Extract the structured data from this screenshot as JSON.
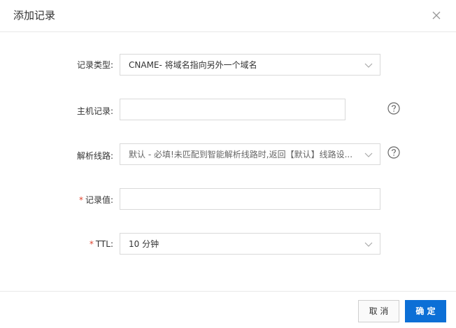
{
  "dialog": {
    "title": "添加记录"
  },
  "form": {
    "record_type": {
      "label": "记录类型:",
      "value": "CNAME- 将域名指向另外一个域名"
    },
    "host_record": {
      "label": "主机记录:",
      "value": ""
    },
    "line": {
      "label": "解析线路:",
      "value": "默认 - 必填!未匹配到智能解析线路时,返回【默认】线路设..."
    },
    "record_value": {
      "required_mark": "*",
      "label": "记录值:",
      "value": ""
    },
    "ttl": {
      "required_mark": "*",
      "label": "TTL:",
      "value": "10 分钟"
    }
  },
  "footer": {
    "cancel_label": "取 消",
    "ok_label": "确 定"
  },
  "colors": {
    "primary": "#0c6fd6",
    "required": "#e0442f",
    "border": "#d9d9d9"
  }
}
